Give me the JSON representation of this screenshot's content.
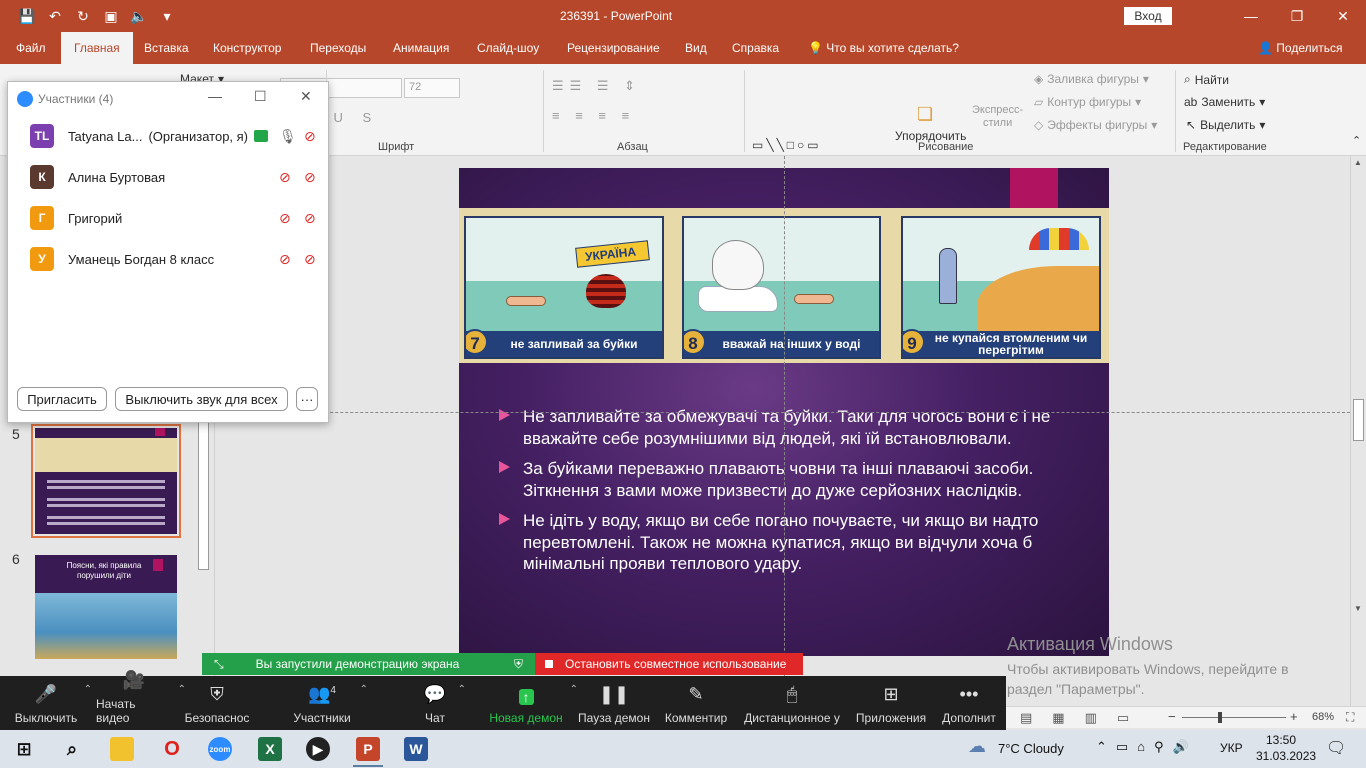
{
  "window": {
    "title": "236391  -  PowerPoint",
    "login_label": "Вход",
    "minimize": "—",
    "restore": "❐",
    "close": "✕"
  },
  "tabs": [
    "Файл",
    "Главная",
    "Вставка",
    "Конструктор",
    "Переходы",
    "Анимация",
    "Слайд-шоу",
    "Рецензирование",
    "Вид",
    "Справка"
  ],
  "active_tab": "Главная",
  "tell_me": "Что вы хотите сделать?",
  "share_label": "Поделиться",
  "ribbon": {
    "layout_label": "Макет",
    "font_size": "72",
    "groups": {
      "font": "Шрифт",
      "paragraph": "Абзац",
      "drawing": "Рисование",
      "editing": "Редактирование"
    },
    "arrange": "Упорядочить",
    "quick_styles": "Экспресс-\nстили",
    "shape_fill": "Заливка фигуры",
    "shape_outline": "Контур фигуры",
    "shape_effects": "Эффекты фигуры",
    "find": "Найти",
    "replace": "Заменить",
    "select": "Выделить"
  },
  "participants": {
    "title": "Участники (4)",
    "list": [
      {
        "initials": "TL",
        "name": "Tatyana La...",
        "role": "(Организатор, я)",
        "color": "#7b3fb0"
      },
      {
        "initials": "К",
        "name": "Алина Буртовая",
        "role": "",
        "color": "#5a3a2e"
      },
      {
        "initials": "Г",
        "name": "Григорий",
        "role": "",
        "color": "#f29a0f"
      },
      {
        "initials": "У",
        "name": "Уманець Богдан 8 класс",
        "role": "",
        "color": "#f29a0f"
      }
    ],
    "invite": "Пригласить",
    "mute_all": "Выключить звук для всех",
    "more": "···"
  },
  "thumbnails": {
    "num5": "5",
    "num6": "6",
    "slide6_title": "Поясни, які правила порушили діти"
  },
  "slide": {
    "panels": [
      {
        "num": "7",
        "caption": "не запливай за буйки",
        "sign": "УКРАЇНА"
      },
      {
        "num": "8",
        "caption": "вважай на інших у воді"
      },
      {
        "num": "9",
        "caption": "не купайся втомленим чи перегрітим"
      }
    ],
    "bullets": [
      "Не запливайте за обмежувачі та буйки. Таки для чогось вони є і не вважайте себе розумнішими від людей, які їй встановлювали.",
      " За буйками переважно плавають човни та інші плаваючі засоби. Зіткнення з вами може призвести до дуже серйозних наслідків.",
      "Не ідіть у воду, якщо ви себе погано почуваєте, чи якщо ви надто перевтомлені. Також не можна купатися, якщо ви відчули хоча б мінімальні прояви теплового удару."
    ]
  },
  "activation": {
    "line1": "Активация Windows",
    "line2": "Чтобы активировать Windows, перейдите в",
    "line3": "раздел \"Параметры\"."
  },
  "status": {
    "zoom": "68%",
    "minus": "−",
    "plus": "+"
  },
  "zoom_share": {
    "sharing": "Вы запустили демонстрацию экрана",
    "stop": "Остановить совместное использование"
  },
  "zoom_bar": {
    "mute": "Выключить",
    "video": "Начать видео",
    "security": "Безопаснос",
    "participants": "Участники",
    "participants_count": "4",
    "chat": "Чат",
    "new_share": "Новая демон",
    "pause_share": "Пауза демон",
    "annotate": "Комментир",
    "remote": "Дистанционное у",
    "apps": "Приложения",
    "more": "Дополнит"
  },
  "taskbar": {
    "weather": "7°C  Cloudy",
    "lang": "УКР",
    "time": "13:50",
    "date": "31.03.2023"
  }
}
